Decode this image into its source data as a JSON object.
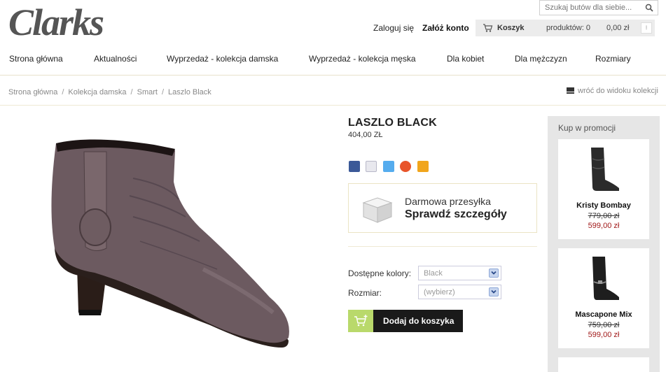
{
  "header": {
    "brand": "Clarks",
    "search_placeholder": "Szukaj butów dla siebie...",
    "login": "Zaloguj się",
    "register": "Załóż konto",
    "cart": {
      "title": "Koszyk",
      "count": "produktów: 0",
      "total": "0,00 zł"
    }
  },
  "nav": [
    "Strona główna",
    "Aktualności",
    "Wyprzedaż - kolekcja damska",
    "Wyprzedaż - kolekcja męska",
    "Dla kobiet",
    "Dla mężczyzn",
    "Rozmiary"
  ],
  "breadcrumb": [
    "Strona główna",
    "Kolekcja damska",
    "Smart",
    "Laszlo Black"
  ],
  "back_link": "wróć do widoku kolekcji",
  "product": {
    "title": "LASZLO BLACK",
    "price": "404,00 ZŁ",
    "shipping_line1": "Darmowa przesyłka",
    "shipping_line2": "Sprawdź szczegóły",
    "colors_label": "Dostępne kolory:",
    "colors_value": "Black",
    "size_label": "Rozmiar:",
    "size_value": "(wybierz)",
    "add_to_cart": "Dodaj do koszyka"
  },
  "social_icons": [
    "facebook-icon",
    "email-icon",
    "twitter-icon",
    "blip-icon",
    "wykop-icon"
  ],
  "colors": {
    "accent_green": "#b9d96b",
    "sale_red": "#a01818",
    "cart_bg": "#ececec",
    "sidebar_bg": "#e6e6e6"
  },
  "promo": {
    "title": "Kup w promocji",
    "items": [
      {
        "name": "Kristy Bombay",
        "old_price": "779,00 zł",
        "new_price": "599,00 zł"
      },
      {
        "name": "Mascapone Mix",
        "old_price": "759,00 zł",
        "new_price": "599,00 zł"
      }
    ]
  }
}
